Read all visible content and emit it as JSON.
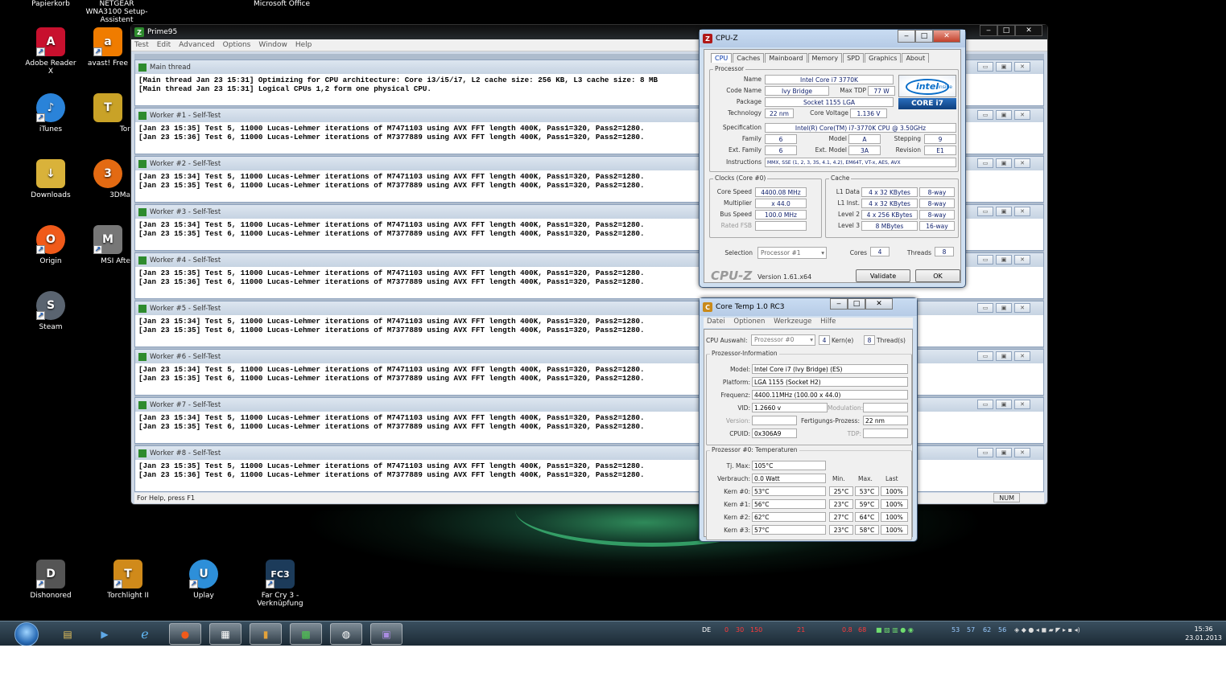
{
  "desktop": {
    "top_labels": [
      {
        "text": "Papierkorb"
      },
      {
        "text": "NETGEAR WNA3100 Setup-Assistent"
      },
      {
        "text": "Microsoft Office"
      }
    ],
    "icons": [
      {
        "label": "Adobe Reader X",
        "glyph": "A",
        "color": "#c8102e"
      },
      {
        "label": "avast! Free",
        "glyph": "a",
        "color": "#f07c00"
      },
      {
        "label": "iTunes",
        "glyph": "♪",
        "color": "#2a83d9"
      },
      {
        "label": "Tor",
        "glyph": "T",
        "color": "#c9a227"
      },
      {
        "label": "Downloads",
        "glyph": "↓",
        "color": "#d9b23a"
      },
      {
        "label": "3DMa",
        "glyph": "3",
        "color": "#e36a12"
      },
      {
        "label": "Origin",
        "glyph": "O",
        "color": "#f05a1a"
      },
      {
        "label": "MSI Afte",
        "glyph": "M",
        "color": "#777"
      },
      {
        "label": "Steam",
        "glyph": "S",
        "color": "#5a6470"
      },
      {
        "label": "Dishonored",
        "glyph": "D",
        "color": "#555"
      },
      {
        "label": "Torchlight II",
        "glyph": "T",
        "color": "#d08a1a"
      },
      {
        "label": "Uplay",
        "glyph": "U",
        "color": "#2d8fd9"
      },
      {
        "label": "Far Cry 3 - Verknüpfung",
        "glyph": "FC3",
        "color": "#1c3b5a"
      }
    ]
  },
  "prime95": {
    "title": "Prime95",
    "menu": [
      "Test",
      "Edit",
      "Advanced",
      "Options",
      "Window",
      "Help"
    ],
    "status": "For Help, press F1",
    "num": "NUM",
    "threads": [
      {
        "title": "Main thread",
        "lines": [
          "[Main thread Jan 23 15:31] Optimizing for CPU architecture: Core i3/i5/i7, L2 cache size: 256 KB, L3 cache size: 8 MB",
          "[Main thread Jan 23 15:31] Logical CPUs 1,2 form one physical CPU."
        ]
      },
      {
        "title": "Worker #1 - Self-Test",
        "lines": [
          "[Jan 23 15:35] Test 5, 11000 Lucas-Lehmer iterations of M7471103 using AVX FFT length 400K, Pass1=320, Pass2=1280.",
          "[Jan 23 15:36] Test 6, 11000 Lucas-Lehmer iterations of M7377889 using AVX FFT length 400K, Pass1=320, Pass2=1280."
        ]
      },
      {
        "title": "Worker #2 - Self-Test",
        "lines": [
          "[Jan 23 15:34] Test 5, 11000 Lucas-Lehmer iterations of M7471103 using AVX FFT length 400K, Pass1=320, Pass2=1280.",
          "[Jan 23 15:35] Test 6, 11000 Lucas-Lehmer iterations of M7377889 using AVX FFT length 400K, Pass1=320, Pass2=1280."
        ]
      },
      {
        "title": "Worker #3 - Self-Test",
        "lines": [
          "[Jan 23 15:34] Test 5, 11000 Lucas-Lehmer iterations of M7471103 using AVX FFT length 400K, Pass1=320, Pass2=1280.",
          "[Jan 23 15:35] Test 6, 11000 Lucas-Lehmer iterations of M7377889 using AVX FFT length 400K, Pass1=320, Pass2=1280."
        ]
      },
      {
        "title": "Worker #4 - Self-Test",
        "lines": [
          "[Jan 23 15:35] Test 5, 11000 Lucas-Lehmer iterations of M7471103 using AVX FFT length 400K, Pass1=320, Pass2=1280.",
          "[Jan 23 15:36] Test 6, 11000 Lucas-Lehmer iterations of M7377889 using AVX FFT length 400K, Pass1=320, Pass2=1280."
        ]
      },
      {
        "title": "Worker #5 - Self-Test",
        "lines": [
          "[Jan 23 15:34] Test 5, 11000 Lucas-Lehmer iterations of M7471103 using AVX FFT length 400K, Pass1=320, Pass2=1280.",
          "[Jan 23 15:35] Test 6, 11000 Lucas-Lehmer iterations of M7377889 using AVX FFT length 400K, Pass1=320, Pass2=1280."
        ]
      },
      {
        "title": "Worker #6 - Self-Test",
        "lines": [
          "[Jan 23 15:34] Test 5, 11000 Lucas-Lehmer iterations of M7471103 using AVX FFT length 400K, Pass1=320, Pass2=1280.",
          "[Jan 23 15:35] Test 6, 11000 Lucas-Lehmer iterations of M7377889 using AVX FFT length 400K, Pass1=320, Pass2=1280."
        ]
      },
      {
        "title": "Worker #7 - Self-Test",
        "lines": [
          "[Jan 23 15:34] Test 5, 11000 Lucas-Lehmer iterations of M7471103 using AVX FFT length 400K, Pass1=320, Pass2=1280.",
          "[Jan 23 15:35] Test 6, 11000 Lucas-Lehmer iterations of M7377889 using AVX FFT length 400K, Pass1=320, Pass2=1280."
        ]
      },
      {
        "title": "Worker #8 - Self-Test",
        "lines": [
          "[Jan 23 15:35] Test 5, 11000 Lucas-Lehmer iterations of M7471103 using AVX FFT length 400K, Pass1=320, Pass2=1280.",
          "[Jan 23 15:36] Test 6, 11000 Lucas-Lehmer iterations of M7377889 using AVX FFT length 400K, Pass1=320, Pass2=1280."
        ]
      }
    ]
  },
  "cpuz": {
    "title": "CPU-Z",
    "tabs": [
      "CPU",
      "Caches",
      "Mainboard",
      "Memory",
      "SPD",
      "Graphics",
      "About"
    ],
    "processor_legend": "Processor",
    "name_label": "Name",
    "name": "Intel Core i7 3770K",
    "codename_label": "Code Name",
    "codename": "Ivy Bridge",
    "maxtdp_label": "Max TDP",
    "maxtdp": "77 W",
    "package_label": "Package",
    "package": "Socket 1155 LGA",
    "technology_label": "Technology",
    "technology": "22 nm",
    "corevoltage_label": "Core Voltage",
    "corevoltage": "1.136 V",
    "spec_label": "Specification",
    "spec": "Intel(R) Core(TM) i7-3770K CPU @ 3.50GHz",
    "family_label": "Family",
    "family": "6",
    "model_label": "Model",
    "model": "A",
    "stepping_label": "Stepping",
    "stepping": "9",
    "extfamily_label": "Ext. Family",
    "extfamily": "6",
    "extmodel_label": "Ext. Model",
    "extmodel": "3A",
    "revision_label": "Revision",
    "revision": "E1",
    "instructions_label": "Instructions",
    "instructions": "MMX, SSE (1, 2, 3, 3S, 4.1, 4.2), EM64T, VT-x, AES, AVX",
    "clocks_legend": "Clocks (Core #0)",
    "corespeed_label": "Core Speed",
    "corespeed": "4400.08 MHz",
    "multiplier_label": "Multiplier",
    "multiplier": "x 44.0",
    "busspeed_label": "Bus Speed",
    "busspeed": "100.0 MHz",
    "ratedfsb_label": "Rated FSB",
    "ratedfsb": "",
    "cache_legend": "Cache",
    "l1data_label": "L1 Data",
    "l1data": "4 x 32 KBytes",
    "l1data_way": "8-way",
    "l1inst_label": "L1 Inst.",
    "l1inst": "4 x 32 KBytes",
    "l1inst_way": "8-way",
    "l2_label": "Level 2",
    "l2": "4 x 256 KBytes",
    "l2_way": "8-way",
    "l3_label": "Level 3",
    "l3": "8 MBytes",
    "l3_way": "16-way",
    "selection_label": "Selection",
    "selection": "Processor #1",
    "cores_label": "Cores",
    "cores": "4",
    "threads_label": "Threads",
    "threads": "8",
    "brand": "CPU-Z",
    "version": "Version 1.61.x64",
    "validate": "Validate",
    "ok": "OK",
    "intel_logo": "intel",
    "intel_inside": "inside",
    "core_badge": "CORE i7"
  },
  "coretemp": {
    "title": "Core Temp 1.0 RC3",
    "menu": [
      "Datei",
      "Optionen",
      "Werkzeuge",
      "Hilfe"
    ],
    "cpu_select_label": "CPU Auswahl:",
    "cpu_select": "Prozessor #0",
    "kerne": "4",
    "kerne_label": "Kern(e)",
    "threads": "8",
    "threads_label": "Thread(s)",
    "info_legend": "Prozessor-Information",
    "model_label": "Model:",
    "model": "Intel Core i7 (Ivy Bridge)  (ES)",
    "platform_label": "Platform:",
    "platform": "LGA 1155 (Socket H2)",
    "freq_label": "Frequenz:",
    "freq": "4400.11MHz (100.00 x 44.0)",
    "vid_label": "VID:",
    "vid": "1.2660 v",
    "modulation_label": "Modulation:",
    "version_label": "Version:",
    "process_label": "Fertigungs-Prozess:",
    "process": "22 nm",
    "cpuid_label": "CPUID:",
    "cpuid": "0x306A9",
    "tdp_label": "TDP:",
    "temp_legend": "Prozessor #0: Temperaturen",
    "tjmax_label": "Tj. Max:",
    "tjmax": "105°C",
    "power_label": "Verbrauch:",
    "power": "0.0 Watt",
    "col_min": "Min.",
    "col_max": "Max.",
    "col_load": "Last",
    "cores": [
      {
        "label": "Kern #0:",
        "temp": "53°C",
        "min": "25°C",
        "max": "53°C",
        "load": "100%"
      },
      {
        "label": "Kern #1:",
        "temp": "56°C",
        "min": "23°C",
        "max": "59°C",
        "load": "100%"
      },
      {
        "label": "Kern #2:",
        "temp": "62°C",
        "min": "27°C",
        "max": "64°C",
        "load": "100%"
      },
      {
        "label": "Kern #3:",
        "temp": "57°C",
        "min": "23°C",
        "max": "58°C",
        "load": "100%"
      }
    ]
  },
  "taskbar": {
    "lang": "DE",
    "tray_values": [
      "0",
      "30",
      "150",
      "21",
      "0.8",
      "68",
      "53",
      "57",
      "62",
      "56"
    ],
    "time": "15:36",
    "date": "23.01.2013"
  }
}
